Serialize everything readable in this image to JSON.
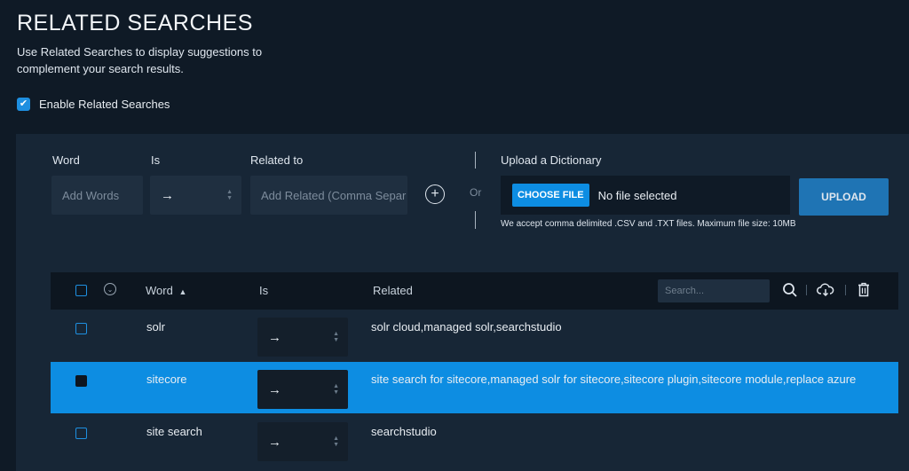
{
  "page": {
    "title": "RELATED SEARCHES",
    "description": "Use Related Searches to display suggestions to complement your search results.",
    "enable_label": "Enable Related Searches",
    "enable_checked": true
  },
  "form": {
    "word_label": "Word",
    "is_label": "Is",
    "related_label": "Related to",
    "word_placeholder": "Add Words",
    "is_value": "→",
    "related_placeholder": "Add Related (Comma Separ",
    "or_label": "Or",
    "upload_label": "Upload a Dictionary",
    "choose_file_label": "CHOOSE FILE",
    "file_status": "No file selected",
    "upload_button": "UPLOAD",
    "accept_note": "We accept comma delimited .CSV and .TXT files. Maximum file size: 10MB"
  },
  "table": {
    "headers": {
      "word": "Word",
      "is": "Is",
      "related": "Related",
      "sort_indicator": "▲"
    },
    "search_placeholder": "Search...",
    "rows": [
      {
        "word": "solr",
        "is": "→",
        "related": "solr cloud,managed solr,searchstudio",
        "selected": false
      },
      {
        "word": "sitecore",
        "is": "→",
        "related": "site search for sitecore,managed solr for sitecore,sitecore plugin,sitecore module,replace azure",
        "selected": true
      },
      {
        "word": "site search",
        "is": "→",
        "related": "searchstudio",
        "selected": false
      }
    ]
  },
  "colors": {
    "background": "#0f1a26",
    "panel": "#172636",
    "accent": "#0d8de2",
    "upload_button": "#1f74b4"
  }
}
